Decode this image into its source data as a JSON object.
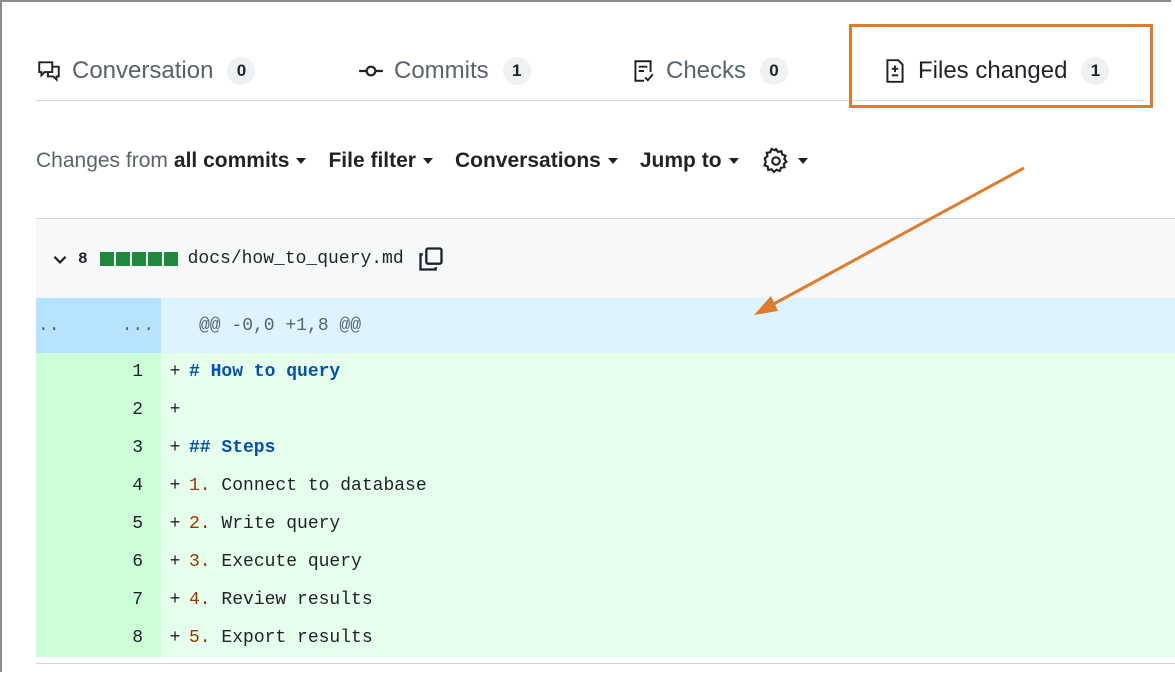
{
  "tabs": [
    {
      "label": "Conversation",
      "count": "0",
      "icon": "comment-discussion-icon"
    },
    {
      "label": "Commits",
      "count": "1",
      "icon": "git-commit-icon"
    },
    {
      "label": "Checks",
      "count": "0",
      "icon": "checklist-icon"
    },
    {
      "label": "Files changed",
      "count": "1",
      "icon": "file-diff-icon"
    }
  ],
  "toolbar": {
    "changes_prefix": "Changes from",
    "changes_value": "all commits",
    "file_filter": "File filter",
    "conversations": "Conversations",
    "jump_to": "Jump to"
  },
  "file": {
    "change_count": "8",
    "path": "docs/how_to_query.md"
  },
  "diff": {
    "hunk_left": "..",
    "hunk_right": "...",
    "hunk_header": "@@ -0,0 +1,8 @@",
    "lines": [
      {
        "num": "1",
        "sign": "+",
        "prefix": "",
        "text": "# How to query",
        "style": "heading"
      },
      {
        "num": "2",
        "sign": "+",
        "prefix": "",
        "text": "",
        "style": "plain"
      },
      {
        "num": "3",
        "sign": "+",
        "prefix": "",
        "text": "## Steps",
        "style": "heading"
      },
      {
        "num": "4",
        "sign": "+",
        "prefix": "1.",
        "text": " Connect to database",
        "style": "list"
      },
      {
        "num": "5",
        "sign": "+",
        "prefix": "2.",
        "text": " Write query",
        "style": "list"
      },
      {
        "num": "6",
        "sign": "+",
        "prefix": "3.",
        "text": " Execute query",
        "style": "list"
      },
      {
        "num": "7",
        "sign": "+",
        "prefix": "4.",
        "text": " Review results",
        "style": "list"
      },
      {
        "num": "8",
        "sign": "+",
        "prefix": "5.",
        "text": " Export results",
        "style": "list"
      }
    ]
  },
  "colors": {
    "highlight": "#e07b2b",
    "added_bg": "#e6ffec",
    "added_gutter": "#ccffd8",
    "hunk_bg": "#ddf4ff",
    "diffstat_green": "#1f883d"
  }
}
